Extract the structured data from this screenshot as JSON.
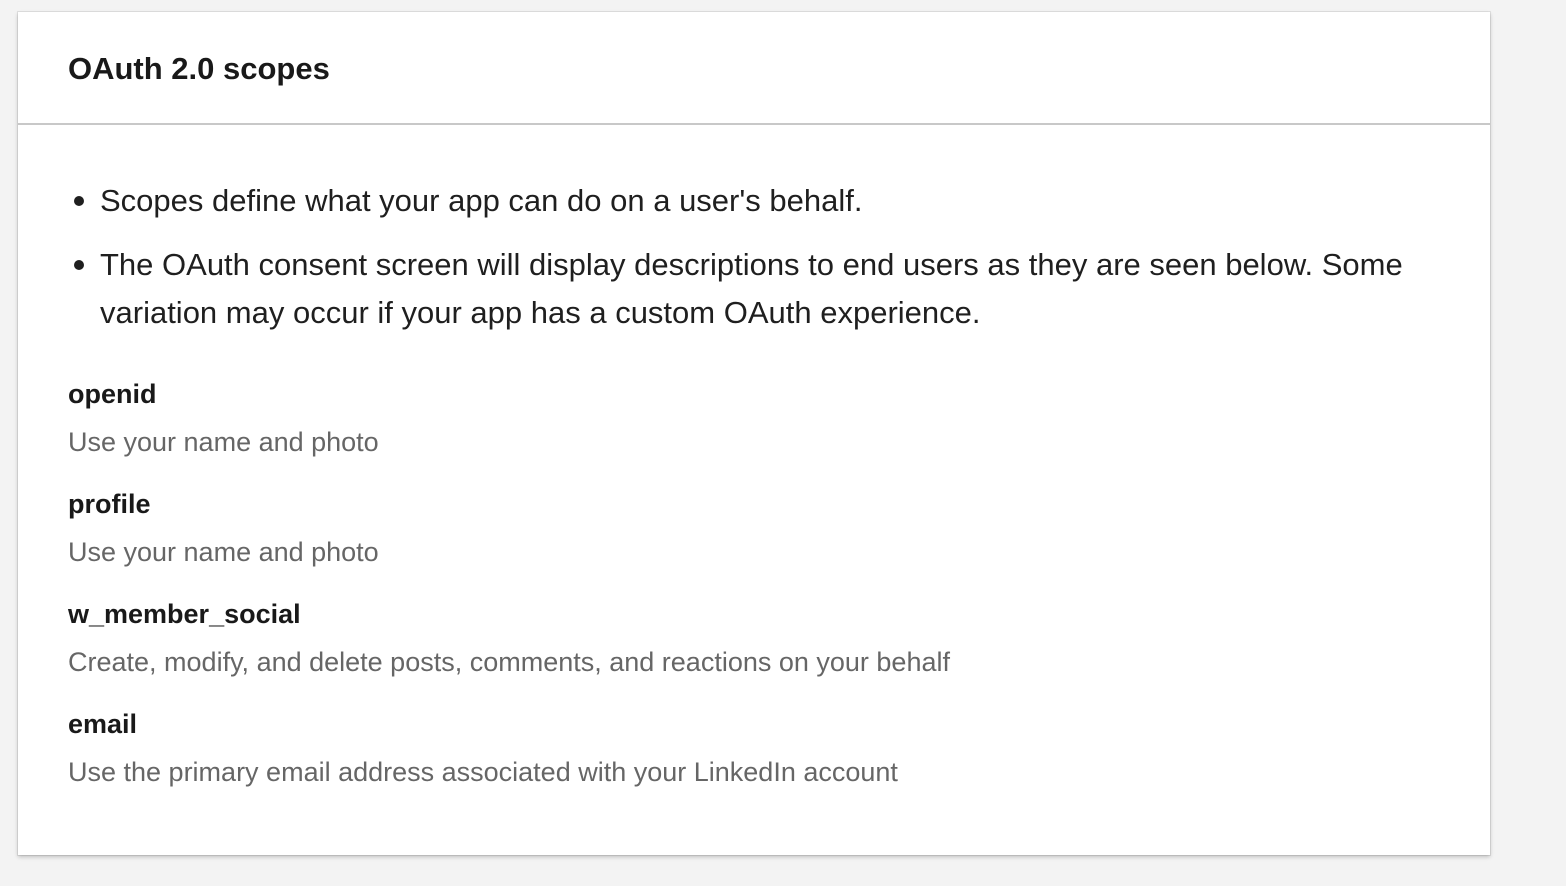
{
  "card": {
    "title": "OAuth 2.0 scopes"
  },
  "bullets": [
    "Scopes define what your app can do on a user's behalf.",
    "The OAuth consent screen will display descriptions to end users as they are seen below. Some variation may occur if your app has a custom OAuth experience."
  ],
  "scopes": [
    {
      "name": "openid",
      "description": "Use your name and photo"
    },
    {
      "name": "profile",
      "description": "Use your name and photo"
    },
    {
      "name": "w_member_social",
      "description": "Create, modify, and delete posts, comments, and reactions on your behalf"
    },
    {
      "name": "email",
      "description": "Use the primary email address associated with your LinkedIn account"
    }
  ],
  "colors": {
    "page_background": "#f3f3f3",
    "card_background": "#ffffff",
    "text_primary": "#191919",
    "text_secondary": "#666666",
    "divider": "#c8c8c8"
  }
}
